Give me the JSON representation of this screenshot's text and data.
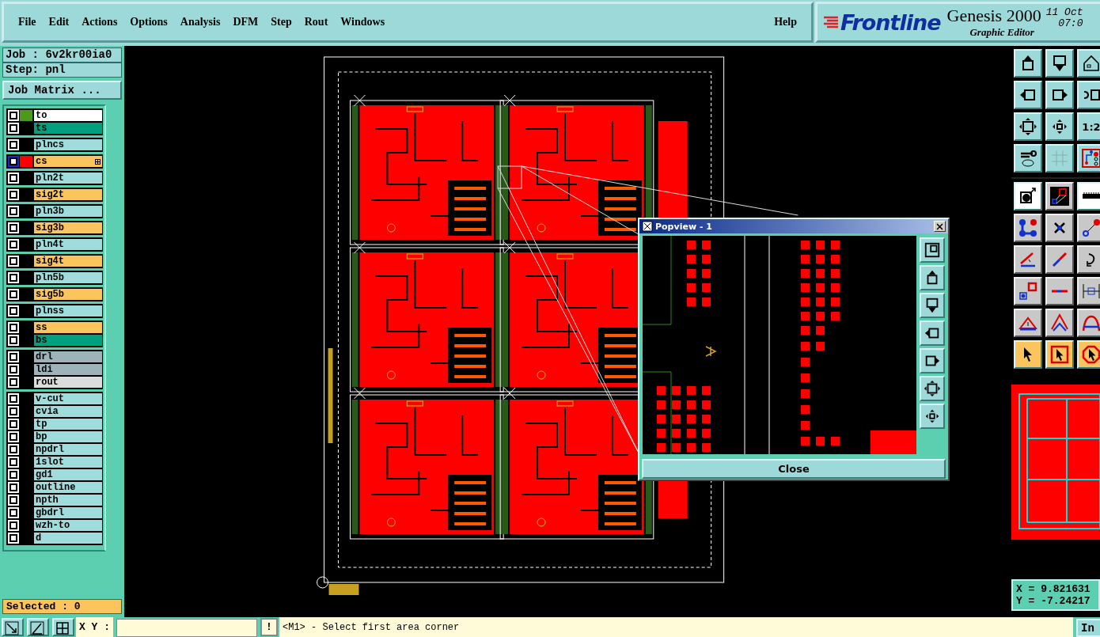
{
  "menu": [
    {
      "label": "File"
    },
    {
      "label": "Edit"
    },
    {
      "label": "Actions"
    },
    {
      "label": "Options"
    },
    {
      "label": "Analysis"
    },
    {
      "label": "DFM"
    },
    {
      "label": "Step"
    },
    {
      "label": "Rout"
    },
    {
      "label": "Windows"
    }
  ],
  "help": "Help",
  "brand": {
    "logo": "Frontline",
    "product": "Genesis 2000",
    "subtitle": "Graphic Editor",
    "date": "11 Oct",
    "time": "07:0"
  },
  "job": {
    "job": "Job : 6v2kr00ia0",
    "step": "Step: pnl",
    "matrix_button": "Job Matrix ..."
  },
  "layer_groups": [
    {
      "layers": [
        {
          "name": "to",
          "kind": "silk_screen",
          "color": "#4c9a1c",
          "selected": false
        },
        {
          "name": "ts",
          "kind": "solder_mask",
          "selected": false
        }
      ]
    },
    {
      "layers": [
        {
          "name": "plncs",
          "kind": "power_ground",
          "selected": false
        }
      ]
    },
    {
      "layers": [
        {
          "name": "cs",
          "kind": "signal",
          "color": "#ff0000",
          "selected": true
        }
      ]
    },
    {
      "layers": [
        {
          "name": "pln2t",
          "kind": "power_ground",
          "selected": false
        }
      ]
    },
    {
      "layers": [
        {
          "name": "sig2t",
          "kind": "signal",
          "selected": false
        }
      ]
    },
    {
      "layers": [
        {
          "name": "pln3b",
          "kind": "power_ground",
          "selected": false
        }
      ]
    },
    {
      "layers": [
        {
          "name": "sig3b",
          "kind": "signal",
          "selected": false
        }
      ]
    },
    {
      "layers": [
        {
          "name": "pln4t",
          "kind": "power_ground",
          "selected": false
        }
      ]
    },
    {
      "layers": [
        {
          "name": "sig4t",
          "kind": "signal",
          "selected": false
        }
      ]
    },
    {
      "layers": [
        {
          "name": "pln5b",
          "kind": "power_ground",
          "selected": false
        }
      ]
    },
    {
      "layers": [
        {
          "name": "sig5b",
          "kind": "signal",
          "selected": false
        }
      ]
    },
    {
      "layers": [
        {
          "name": "plnss",
          "kind": "power_ground",
          "selected": false
        }
      ]
    },
    {
      "layers": [
        {
          "name": "ss",
          "kind": "signal",
          "selected": false
        },
        {
          "name": "bs",
          "kind": "solder_mask",
          "selected": false
        }
      ]
    },
    {
      "layers": [
        {
          "name": "drl",
          "kind": "drill",
          "selected": false
        },
        {
          "name": "ldi",
          "kind": "drill",
          "selected": false
        },
        {
          "name": "rout",
          "kind": "rout",
          "selected": false
        }
      ]
    },
    {
      "layers": [
        {
          "name": "v-cut",
          "kind": "document",
          "selected": false
        },
        {
          "name": "cvia",
          "kind": "document",
          "selected": false
        },
        {
          "name": "tp",
          "kind": "document",
          "selected": false
        },
        {
          "name": "bp",
          "kind": "document",
          "selected": false
        },
        {
          "name": "npdrl",
          "kind": "document",
          "selected": false
        },
        {
          "name": "1slot",
          "kind": "document",
          "selected": false
        },
        {
          "name": "gd1",
          "kind": "document",
          "selected": false
        },
        {
          "name": "outline",
          "kind": "document",
          "selected": false
        },
        {
          "name": "npth",
          "kind": "document",
          "selected": false
        },
        {
          "name": "gbdrl",
          "kind": "document",
          "selected": false
        },
        {
          "name": "wzh-to",
          "kind": "document",
          "selected": false
        },
        {
          "name": "d",
          "kind": "document",
          "selected": false
        }
      ]
    }
  ],
  "selected_count": "Selected : 0",
  "toolbar": {
    "zoom_label": "1:2"
  },
  "popview": {
    "title": "Popview - 1",
    "close": "Close"
  },
  "coordinates": {
    "x": "X = 9.821631",
    "y": "Y = -7.24217"
  },
  "bottom": {
    "xy_label": "X Y :",
    "bang": "!",
    "status": "<M1> - Select first area corner",
    "in_button": "In"
  }
}
